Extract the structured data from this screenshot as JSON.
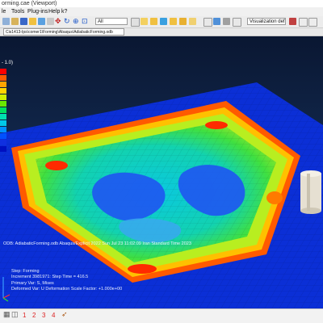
{
  "window": {
    "title": "orming.cae (Viewport)"
  },
  "menu": [
    "le",
    "Tools",
    "Plug-ins",
    "Help",
    "k?"
  ],
  "toolbar": {
    "model_select": "All",
    "visualization_select": "Visualization defaults"
  },
  "path_bar": {
    "value": "Cis1413-Ips\\comer1\\Forming\\Abaqus\\AdiabaticForming.odb"
  },
  "legend": {
    "title": "- 1.0)",
    "labels": [
      "",
      "",
      "",
      "",
      "",
      "",
      "",
      "",
      "",
      "",
      "",
      "",
      ""
    ],
    "colors": [
      "#ff0000",
      "#ff5a00",
      "#ffa400",
      "#ffd400",
      "#d0f000",
      "#6ae800",
      "#00e060",
      "#00e0b0",
      "#00c8e8",
      "#0090ff",
      "#0050ff",
      "#1030e0",
      "#0010c0"
    ]
  },
  "viewport_info": {
    "odb_line": "ODB: AdiabaticForming.odb    Abaqus/Explicit 2022    Sun Jul 23 11:02:09 Iran Standard Time 2023"
  },
  "step_block": {
    "step": "Step: Forming",
    "increment": "Increment  3981971: Step Time =     416.5",
    "primary_var": "Primary Var: S, Mises",
    "deformed_var": "Deformed Var: U   Deformation Scale Factor: +1.000e+00"
  },
  "bottom_bar": {
    "buttons": [
      "1",
      "2",
      "3",
      "4"
    ]
  },
  "colors": {
    "bg_dark": "#0a1732",
    "plate_blue": "#0a2fd8",
    "plate_edge": "#0a1ca8",
    "stress_red": "#ff2a00"
  }
}
